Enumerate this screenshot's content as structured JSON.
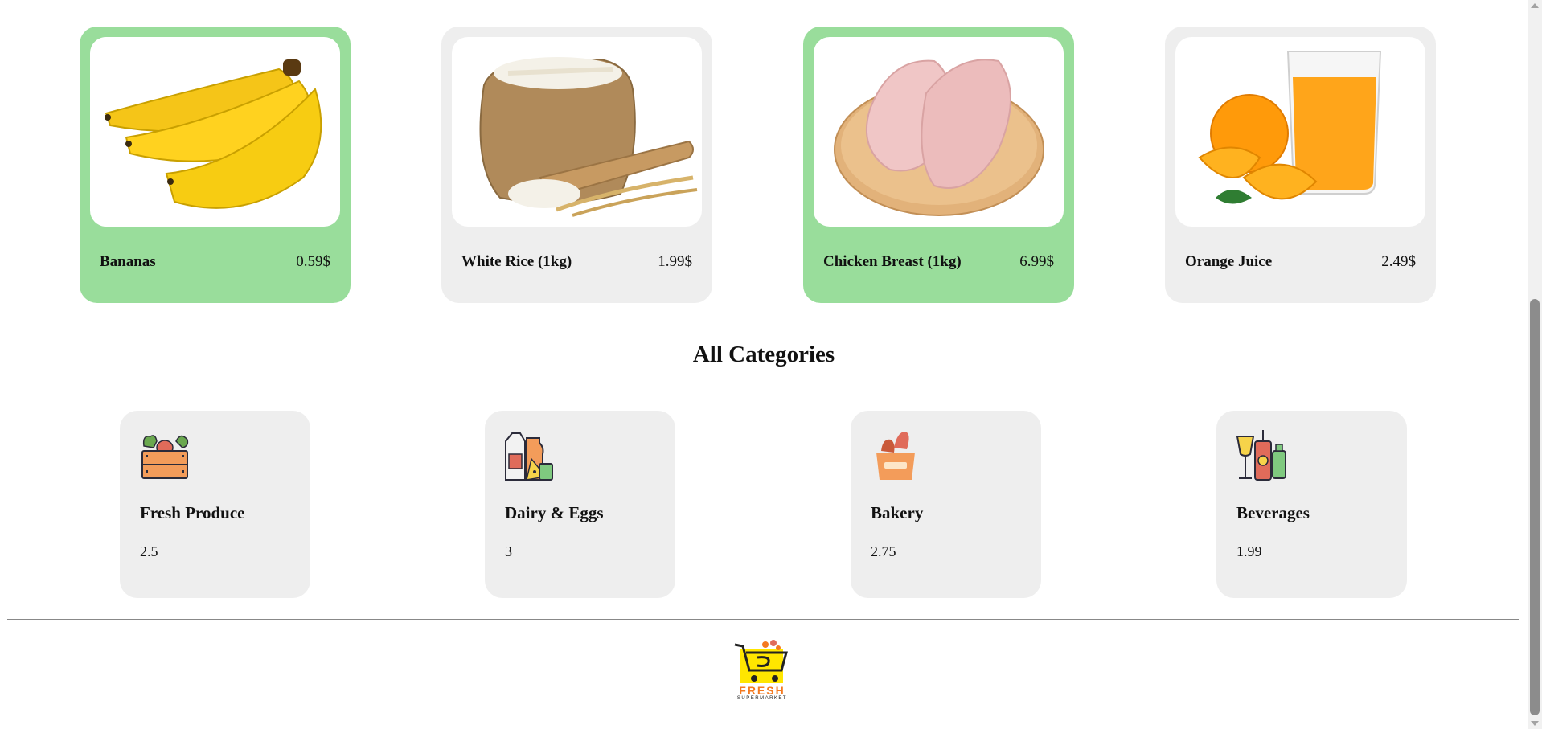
{
  "products": [
    {
      "name": "Bananas",
      "price": "0.59$",
      "highlighted": true,
      "image_icon": "bananas-image"
    },
    {
      "name": "White Rice (1kg)",
      "price": "1.99$",
      "highlighted": false,
      "image_icon": "rice-sack-image"
    },
    {
      "name": "Chicken Breast (1kg)",
      "price": "6.99$",
      "highlighted": true,
      "image_icon": "chicken-breast-image"
    },
    {
      "name": "Orange Juice",
      "price": "2.49$",
      "highlighted": false,
      "image_icon": "orange-juice-image"
    }
  ],
  "categories_section": {
    "title": "All Categories"
  },
  "categories": [
    {
      "name": "Fresh Produce",
      "value": "2.5",
      "icon": "vegetable-crate-icon"
    },
    {
      "name": "Dairy & Eggs",
      "value": "3",
      "icon": "dairy-products-icon"
    },
    {
      "name": "Bakery",
      "value": "2.75",
      "icon": "bread-bag-icon"
    },
    {
      "name": "Beverages",
      "value": "1.99",
      "icon": "drinks-icon"
    }
  ],
  "footer": {
    "logo_word": "FRESH",
    "logo_sub": "SUPERMARKET",
    "logo_icon": "shopping-cart-logo-icon"
  },
  "colors": {
    "highlight": "#99dd9b",
    "card": "#eeeeee",
    "logo_accent": "#f47a20",
    "logo_bg": "#ffe600"
  }
}
